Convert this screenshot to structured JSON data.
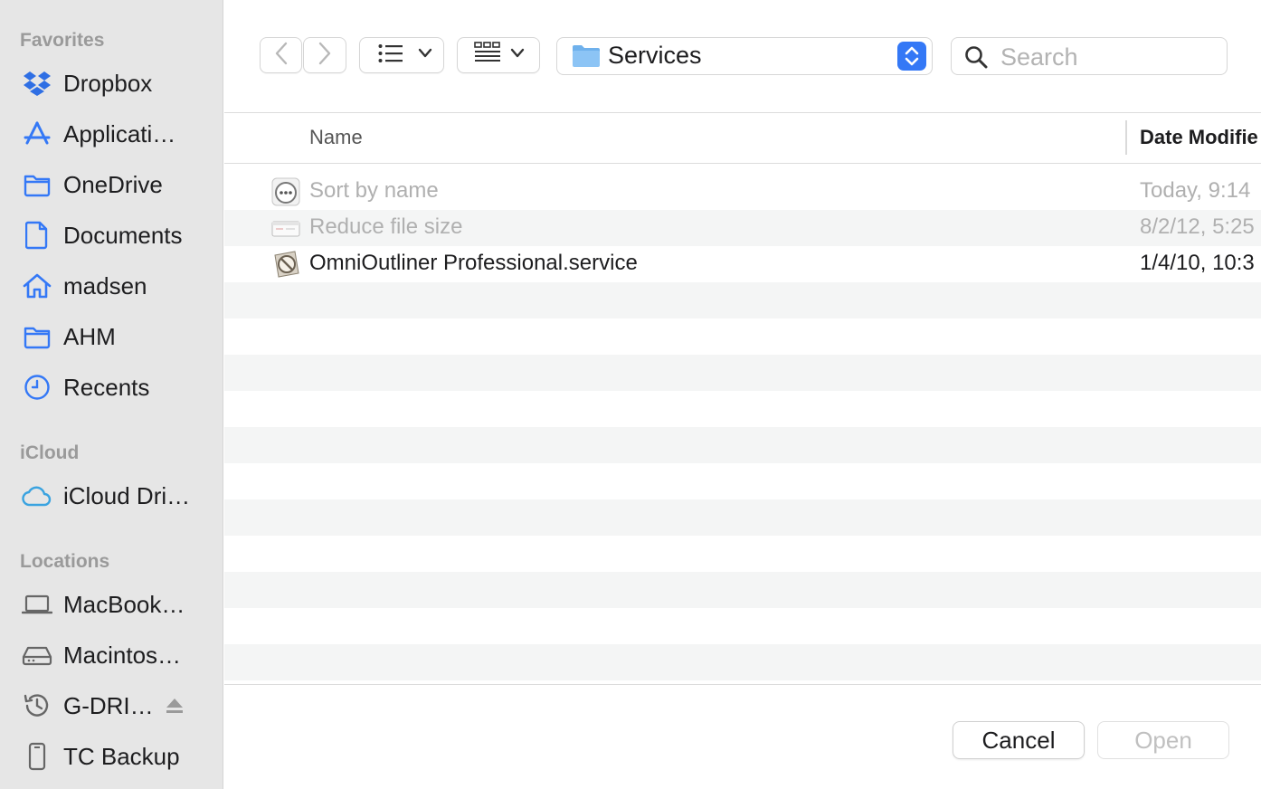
{
  "sidebar": {
    "sections": {
      "favorites": "Favorites",
      "icloud": "iCloud",
      "locations": "Locations"
    },
    "favorites": [
      {
        "label": "Dropbox",
        "icon": "dropbox-icon"
      },
      {
        "label": "Applicati…",
        "icon": "applications-icon"
      },
      {
        "label": "OneDrive",
        "icon": "folder-icon"
      },
      {
        "label": "Documents",
        "icon": "document-icon"
      },
      {
        "label": "madsen",
        "icon": "home-icon"
      },
      {
        "label": "AHM",
        "icon": "folder-icon"
      },
      {
        "label": "Recents",
        "icon": "clock-icon"
      }
    ],
    "icloud": [
      {
        "label": "iCloud Dri…",
        "icon": "cloud-icon"
      }
    ],
    "locations": [
      {
        "label": "MacBook…",
        "icon": "laptop-icon"
      },
      {
        "label": "Macintos…",
        "icon": "disk-icon"
      },
      {
        "label": "G-DRI…",
        "icon": "time-machine-icon"
      },
      {
        "label": "TC Backup",
        "icon": "time-capsule-icon"
      }
    ],
    "accent_color": "#3478f6"
  },
  "toolbar": {
    "path_label": "Services",
    "search_placeholder": "Search"
  },
  "file_list": {
    "columns": {
      "name": "Name",
      "date": "Date Modifie"
    },
    "rows": [
      {
        "name": "Sort by name",
        "date": "Today, 9:14",
        "icon": "service-icon",
        "disabled": true
      },
      {
        "name": "Reduce file size",
        "date": "8/2/12, 5:25",
        "icon": "filter-icon",
        "disabled": true
      },
      {
        "name": "OmniOutliner Professional.service",
        "date": "1/4/10, 10:3",
        "icon": "omnioutliner-icon",
        "disabled": false
      }
    ]
  },
  "buttons": {
    "cancel": "Cancel",
    "open": "Open"
  }
}
